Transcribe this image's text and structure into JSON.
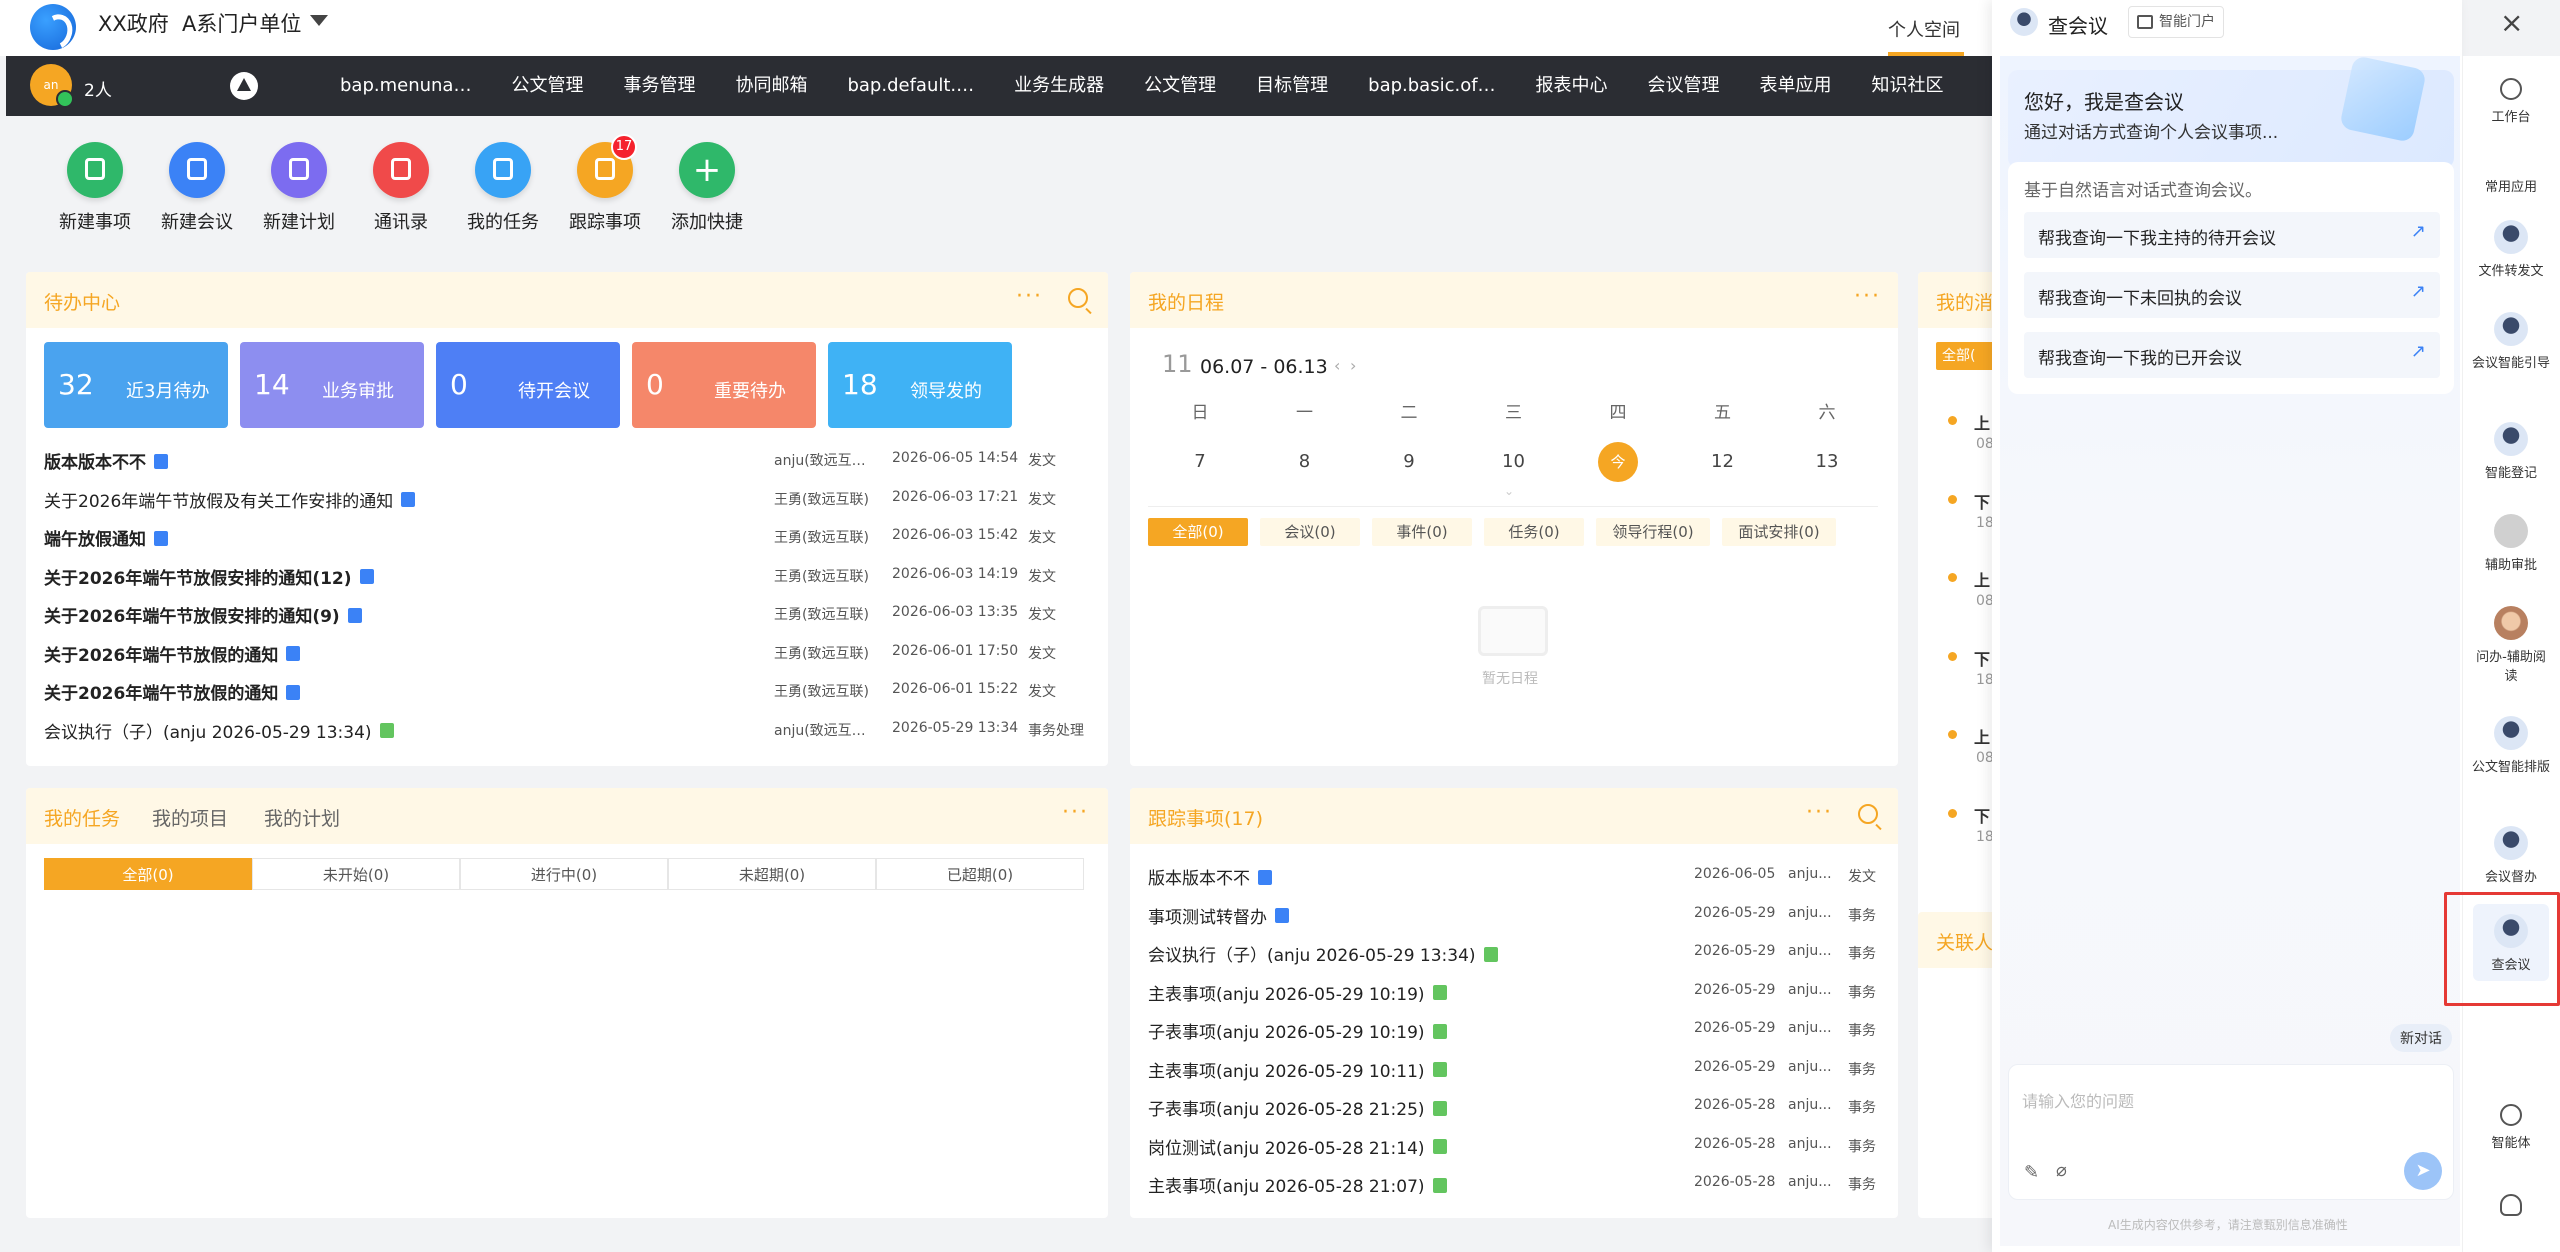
{
  "header": {
    "org": "XX政府",
    "unit": "A系门户单位",
    "personal_space": "个人空间"
  },
  "nav": {
    "people_count": "2人",
    "avatar_text": "an",
    "items": [
      "bap.menuna…",
      "公文管理",
      "事务管理",
      "协同邮箱",
      "bap.default.…",
      "业务生成器",
      "公文管理",
      "目标管理",
      "bap.basic.of…",
      "报表中心",
      "会议管理",
      "表单应用",
      "知识社区"
    ]
  },
  "quick_actions": [
    {
      "label": "新建事项",
      "color": "#2fb86a"
    },
    {
      "label": "新建会议",
      "color": "#3b82f6"
    },
    {
      "label": "新建计划",
      "color": "#7c6cf0"
    },
    {
      "label": "通讯录",
      "color": "#f04a4a"
    },
    {
      "label": "我的任务",
      "color": "#38a3f5"
    },
    {
      "label": "跟踪事项",
      "color": "#f5a623",
      "badge": "17"
    },
    {
      "label": "添加快捷",
      "color": "#2fb86a"
    }
  ],
  "todo": {
    "title": "待办中心",
    "stats": [
      {
        "num": "32",
        "label": "近3月待办",
        "color": "#4aa3ef"
      },
      {
        "num": "14",
        "label": "业务审批",
        "color": "#8d8ef0"
      },
      {
        "num": "0",
        "label": "待开会议",
        "color": "#4e7ff5"
      },
      {
        "num": "0",
        "label": "重要待办",
        "color": "#f5876a"
      },
      {
        "num": "18",
        "label": "领导发的",
        "color": "#3fb2f5"
      }
    ],
    "rows": [
      {
        "title": "版本版本不不",
        "bold": true,
        "icon": "w",
        "author": "anju(致远互…",
        "date": "2026-06-05 14:54",
        "type": "发文"
      },
      {
        "title": "关于2026年端午节放假及有关工作安排的通知",
        "bold": false,
        "icon": "w",
        "author": "王勇(致远互联)",
        "date": "2026-06-03 17:21",
        "type": "发文"
      },
      {
        "title": "端午放假通知",
        "bold": true,
        "icon": "w",
        "author": "王勇(致远互联)",
        "date": "2026-06-03 15:42",
        "type": "发文"
      },
      {
        "title": "关于2026年端午节放假安排的通知(12)",
        "bold": true,
        "icon": "w",
        "author": "王勇(致远互联)",
        "date": "2026-06-03 14:19",
        "type": "发文"
      },
      {
        "title": "关于2026年端午节放假安排的通知(9)",
        "bold": true,
        "icon": "w",
        "author": "王勇(致远互联)",
        "date": "2026-06-03 13:35",
        "type": "发文"
      },
      {
        "title": "关于2026年端午节放假的通知",
        "bold": true,
        "icon": "w",
        "author": "王勇(致远互联)",
        "date": "2026-06-01 17:50",
        "type": "发文"
      },
      {
        "title": "关于2026年端午节放假的通知",
        "bold": true,
        "icon": "w",
        "author": "王勇(致远互联)",
        "date": "2026-06-01 15:22",
        "type": "发文"
      },
      {
        "title": "会议执行（子）(anju 2026-05-29 13:34)",
        "bold": false,
        "icon": "g",
        "author": "anju(致远互…",
        "date": "2026-05-29 13:34",
        "type": "事务处理"
      }
    ]
  },
  "schedule": {
    "title": "我的日程",
    "month": "11",
    "range": "06.07 - 06.13",
    "weekdays": [
      "日",
      "一",
      "二",
      "三",
      "四",
      "五",
      "六"
    ],
    "days": [
      "7",
      "8",
      "9",
      "10",
      "今",
      "12",
      "13"
    ],
    "tabs": [
      "全部(0)",
      "会议(0)",
      "事件(0)",
      "任务(0)",
      "领导行程(0)",
      "面试安排(0)"
    ],
    "empty": "暂无日程"
  },
  "tasks": {
    "tabs_header": [
      "我的任务",
      "我的项目",
      "我的计划"
    ],
    "filters": [
      "全部(0)",
      "未开始(0)",
      "进行中(0)",
      "未超期(0)",
      "已超期(0)"
    ]
  },
  "follow": {
    "title": "跟踪事项(17)",
    "rows": [
      {
        "title": "版本版本不不",
        "icon": "w",
        "date": "2026-06-05",
        "author": "anju...",
        "type": "发文"
      },
      {
        "title": "事项测试转督办",
        "icon": "w",
        "date": "2026-05-29",
        "author": "anju...",
        "type": "事务"
      },
      {
        "title": "会议执行（子）(anju 2026-05-29 13:34)",
        "icon": "g",
        "date": "2026-05-29",
        "author": "anju...",
        "type": "事务"
      },
      {
        "title": "主表事项(anju 2026-05-29 10:19)",
        "icon": "g",
        "date": "2026-05-29",
        "author": "anju...",
        "type": "事务"
      },
      {
        "title": "子表事项(anju 2026-05-29 10:19)",
        "icon": "g",
        "date": "2026-05-29",
        "author": "anju...",
        "type": "事务"
      },
      {
        "title": "主表事项(anju 2026-05-29 10:11)",
        "icon": "g",
        "date": "2026-05-29",
        "author": "anju...",
        "type": "事务"
      },
      {
        "title": "子表事项(anju 2026-05-28 21:25)",
        "icon": "g",
        "date": "2026-05-28",
        "author": "anju...",
        "type": "事务"
      },
      {
        "title": "岗位测试(anju 2026-05-28 21:14)",
        "icon": "g",
        "date": "2026-05-28",
        "author": "anju...",
        "type": "事务"
      },
      {
        "title": "主表事项(anju 2026-05-28 21:07)",
        "icon": "g",
        "date": "2026-05-28",
        "author": "anju...",
        "type": "事务"
      }
    ]
  },
  "messages": {
    "title": "我的消",
    "tab": "全部(",
    "items": [
      {
        "t": "上",
        "s": "08"
      },
      {
        "t": "下",
        "s": "18"
      },
      {
        "t": "上",
        "s": "08"
      },
      {
        "t": "下",
        "s": "18"
      },
      {
        "t": "上",
        "s": "08"
      },
      {
        "t": "下",
        "s": "18"
      }
    ],
    "related": "关联人"
  },
  "chat": {
    "title": "查会议",
    "badge": "智能门户",
    "greeting": "您好，我是查会议",
    "greeting_sub": "通过对话方式查询个人会议事项...",
    "intro": "基于自然语言对话式查询会议。",
    "suggestions": [
      "帮我查询一下我主持的待开会议",
      "帮我查询一下未回执的会议",
      "帮我查询一下我的已开会议"
    ],
    "new_chat": "新对话",
    "placeholder": "请输入您的问题",
    "disclaimer": "AI生成内容仅供参考，请注意甄别信息准确性"
  },
  "rail": {
    "items": [
      "工作台",
      "常用应用",
      "文件转发文",
      "会议智能引导",
      "智能登记",
      "辅助审批",
      "问办-辅助阅读",
      "公文智能排版",
      "会议督办",
      "查会议",
      "智能体"
    ]
  }
}
